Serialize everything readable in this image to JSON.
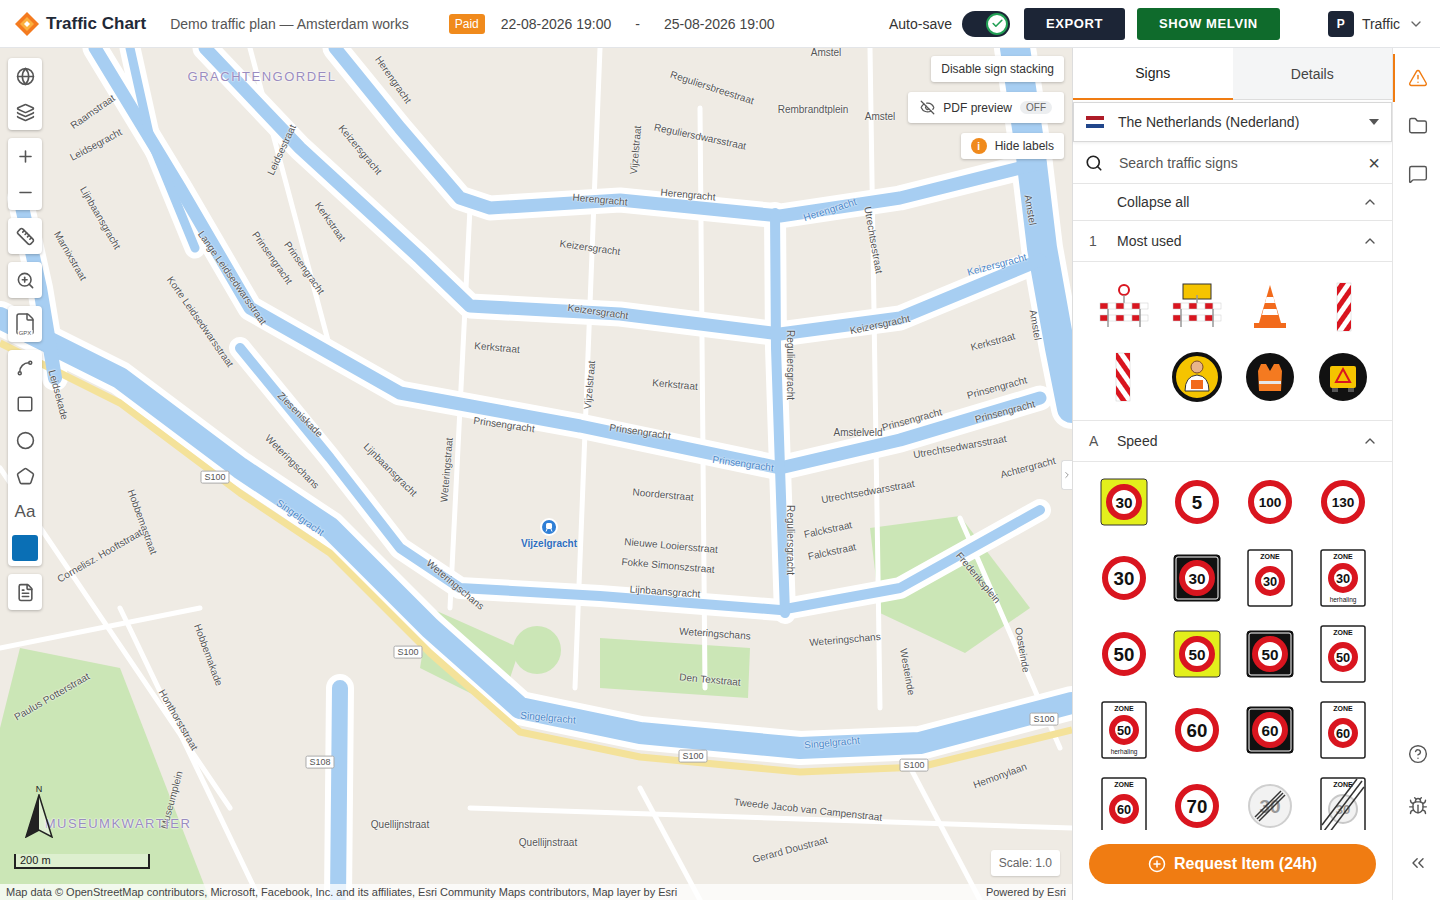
{
  "app": {
    "name": "Traffic Chart"
  },
  "topbar": {
    "plan_title": "Demo traffic plan — Amsterdam works",
    "badge": "Paid",
    "start": "22-08-2026 19:00",
    "separator": "-",
    "end": "25-08-2026 19:00",
    "autosave": {
      "label": "Auto-save",
      "on": true
    },
    "buttons": [
      "EXPORT",
      "SHOW MELVIN"
    ],
    "user": {
      "initial": "P",
      "name": "Traffic"
    }
  },
  "toolbar": {
    "text_tool": "Aa",
    "gpx_label": "GPX",
    "current_color": "#0a6fb5"
  },
  "map": {
    "stacking_button": "Disable sign stacking",
    "pdf_preview": {
      "label": "PDF preview",
      "state": "OFF",
      "on": false
    },
    "labels_button": {
      "label": "Hide labels",
      "icon": "i"
    },
    "scale_bar": "200 m",
    "north": "N",
    "scale": "Scale: 1.0",
    "attribution": "Map data © OpenStreetMap contributors, Microsoft, Facebook, Inc. and its affiliates, Esri Community Maps contributors, Map layer by Esri",
    "powered_by": "Powered by Esri",
    "station": "Vijzelgracht",
    "labels": [
      {
        "text": "GRACHTENGORDEL",
        "kind": "district"
      },
      {
        "text": "Amstel",
        "kind": "street"
      },
      {
        "text": "Reguliersbreestraat",
        "kind": "street"
      },
      {
        "text": "Rembrandtplein",
        "kind": "street"
      },
      {
        "text": "Amstel",
        "kind": "street"
      },
      {
        "text": "Raamstraat",
        "kind": "street"
      },
      {
        "text": "Leidsegracht",
        "kind": "street"
      },
      {
        "text": "Herengracht",
        "kind": "street"
      },
      {
        "text": "Keizersgracht",
        "kind": "street"
      },
      {
        "text": "Leidsestraat",
        "kind": "street"
      },
      {
        "text": "Kerkstraat",
        "kind": "street"
      },
      {
        "text": "Prinsengracht",
        "kind": "street"
      },
      {
        "text": "Prinsengracht",
        "kind": "street"
      },
      {
        "text": "Lange Leidsedwarsstraat",
        "kind": "street"
      },
      {
        "text": "Korte Leidsedwarsstraat",
        "kind": "street"
      },
      {
        "text": "Lijnbaansgracht",
        "kind": "street"
      },
      {
        "text": "Marnixstraat",
        "kind": "street"
      },
      {
        "text": "Reguliersdwarsstraat",
        "kind": "street"
      },
      {
        "text": "Vijzelstraat",
        "kind": "street"
      },
      {
        "text": "Herengracht",
        "kind": "street"
      },
      {
        "text": "Herengracht",
        "kind": "street"
      },
      {
        "text": "Herengracht",
        "kind": "water"
      },
      {
        "text": "Keizersgracht",
        "kind": "street"
      },
      {
        "text": "Keizersgracht",
        "kind": "street"
      },
      {
        "text": "Kerkstraat",
        "kind": "street"
      },
      {
        "text": "Prinsengracht",
        "kind": "street"
      },
      {
        "text": "Prinsengracht",
        "kind": "street"
      },
      {
        "text": "Prinsengracht",
        "kind": "water"
      },
      {
        "text": "Kerkstraat",
        "kind": "street"
      },
      {
        "text": "Vijzelstraat",
        "kind": "street"
      },
      {
        "text": "Noorderstraat",
        "kind": "street"
      },
      {
        "text": "Nieuwe Looiersstraat",
        "kind": "street"
      },
      {
        "text": "Fokke Simonszstraat",
        "kind": "street"
      },
      {
        "text": "Lijnbaansgracht",
        "kind": "street"
      },
      {
        "text": "Weteringschans",
        "kind": "street"
      },
      {
        "text": "Den Texstraat",
        "kind": "street"
      },
      {
        "text": "Singelgracht",
        "kind": "water"
      },
      {
        "text": "Singelgracht",
        "kind": "water"
      },
      {
        "text": "Reguliersgracht",
        "kind": "street"
      },
      {
        "text": "Reguliersgracht",
        "kind": "street"
      },
      {
        "text": "Amstelveld",
        "kind": "street"
      },
      {
        "text": "Keizersgracht",
        "kind": "street"
      },
      {
        "text": "Prinsengracht",
        "kind": "street"
      },
      {
        "text": "Kerkstraat",
        "kind": "street"
      },
      {
        "text": "Prinsengracht",
        "kind": "street"
      },
      {
        "text": "Keizersgracht",
        "kind": "water"
      },
      {
        "text": "Prinsengracht",
        "kind": "street"
      },
      {
        "text": "Utrechtsedwarsstraat",
        "kind": "street"
      },
      {
        "text": "Utrechtsedwarsstraat",
        "kind": "street"
      },
      {
        "text": "Achtergracht",
        "kind": "street"
      },
      {
        "text": "Falckstraat",
        "kind": "street"
      },
      {
        "text": "Falckstraat",
        "kind": "street"
      },
      {
        "text": "Weteringschans",
        "kind": "street"
      },
      {
        "text": "Frederiksplein",
        "kind": "street"
      },
      {
        "text": "Oosteinde",
        "kind": "street"
      },
      {
        "text": "Westeinde",
        "kind": "street"
      },
      {
        "text": "Hemonylaan",
        "kind": "street"
      },
      {
        "text": "Tweede Jacob van Campenstraat",
        "kind": "street"
      },
      {
        "text": "Gerard Doustraat",
        "kind": "street"
      },
      {
        "text": "Quellijnstraat",
        "kind": "street"
      },
      {
        "text": "Quellijnstraat",
        "kind": "street"
      },
      {
        "text": "Hobbemastraat",
        "kind": "street"
      },
      {
        "text": "Hobbemakade",
        "kind": "street"
      },
      {
        "text": "Honthorststraat",
        "kind": "street"
      },
      {
        "text": "Cornelisz. Hooftstraat",
        "kind": "street"
      },
      {
        "text": "Paulus Potterstraat",
        "kind": "street"
      },
      {
        "text": "Museumplein",
        "kind": "street"
      },
      {
        "text": "MUSEUMKWARTIER",
        "kind": "district"
      },
      {
        "text": "Zieseniskade",
        "kind": "street"
      },
      {
        "text": "Weteringschans",
        "kind": "street"
      },
      {
        "text": "Singelgracht",
        "kind": "water"
      },
      {
        "text": "Lijnbaansgracht",
        "kind": "street"
      },
      {
        "text": "Weteringstraat",
        "kind": "street"
      },
      {
        "text": "Leidsekade",
        "kind": "street"
      },
      {
        "text": "Amstel",
        "kind": "street"
      },
      {
        "text": "Amstel",
        "kind": "street"
      },
      {
        "text": "Utrechtsestraat",
        "kind": "street"
      },
      {
        "text": "Weteringschans",
        "kind": "street"
      },
      {
        "text": "S100",
        "kind": "shield"
      },
      {
        "text": "S100",
        "kind": "shield"
      },
      {
        "text": "S100",
        "kind": "shield"
      },
      {
        "text": "S100",
        "kind": "shield"
      },
      {
        "text": "S100",
        "kind": "shield"
      },
      {
        "text": "S108",
        "kind": "shield"
      }
    ]
  },
  "panel": {
    "tabs": [
      {
        "label": "Signs",
        "selected": true
      },
      {
        "label": "Details",
        "selected": false
      }
    ],
    "country": "The Netherlands (Nederland)",
    "search_placeholder": "Search traffic signs",
    "clear": "×",
    "collapse_all": "Collapse all",
    "sections": [
      {
        "key": "1",
        "title": "Most used",
        "expanded": true,
        "items": [
          {
            "kind": "barrier-light"
          },
          {
            "kind": "barrier-board"
          },
          {
            "kind": "cone"
          },
          {
            "kind": "beacon-right"
          },
          {
            "kind": "beacon-left"
          },
          {
            "kind": "worker"
          },
          {
            "kind": "vest"
          },
          {
            "kind": "vehicle"
          }
        ]
      },
      {
        "key": "A",
        "title": "Speed",
        "expanded": true,
        "items": [
          {
            "kind": "yellow-square",
            "value": "30"
          },
          {
            "kind": "round",
            "value": "5"
          },
          {
            "kind": "round",
            "value": "100"
          },
          {
            "kind": "round",
            "value": "130"
          },
          {
            "kind": "round",
            "value": "30"
          },
          {
            "kind": "black-square",
            "value": "30"
          },
          {
            "kind": "zone",
            "label": "ZONE",
            "value": "30"
          },
          {
            "kind": "zone",
            "label": "ZONE",
            "value": "30",
            "sub": "herhaling"
          },
          {
            "kind": "round",
            "value": "50"
          },
          {
            "kind": "yellow-square",
            "value": "50"
          },
          {
            "kind": "black-square",
            "value": "50"
          },
          {
            "kind": "zone",
            "label": "ZONE",
            "value": "50"
          },
          {
            "kind": "zone",
            "label": "ZONE",
            "value": "50",
            "sub": "herhaling"
          },
          {
            "kind": "round",
            "value": "60"
          },
          {
            "kind": "black-square",
            "value": "60"
          },
          {
            "kind": "zone",
            "label": "ZONE",
            "value": "60"
          },
          {
            "kind": "zone",
            "label": "ZONE",
            "value": "60"
          },
          {
            "kind": "round",
            "value": "70"
          },
          {
            "kind": "end",
            "value": "30"
          },
          {
            "kind": "zone-end",
            "label": "ZONE",
            "value": "30"
          }
        ]
      }
    ],
    "request_button": "Request Item (24h)"
  },
  "rail": {
    "items": [
      {
        "kind": "warnings",
        "selected": true
      },
      {
        "kind": "files",
        "selected": false
      },
      {
        "kind": "comments",
        "selected": false
      }
    ],
    "bottom": [
      {
        "kind": "help"
      },
      {
        "kind": "bug"
      },
      {
        "kind": "collapse"
      }
    ]
  }
}
